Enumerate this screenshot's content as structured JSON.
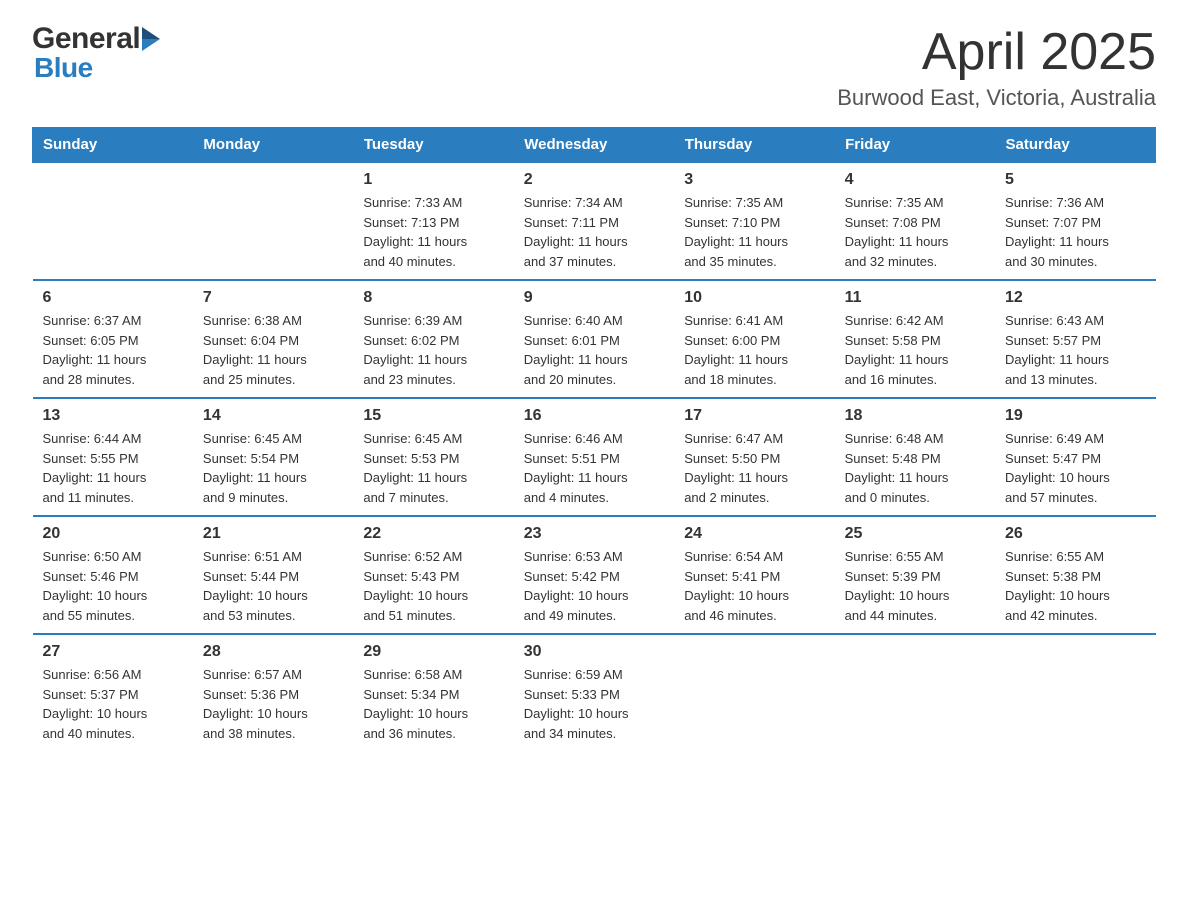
{
  "header": {
    "title": "April 2025",
    "subtitle": "Burwood East, Victoria, Australia"
  },
  "logo": {
    "general": "General",
    "blue": "Blue"
  },
  "calendar": {
    "days": [
      "Sunday",
      "Monday",
      "Tuesday",
      "Wednesday",
      "Thursday",
      "Friday",
      "Saturday"
    ],
    "weeks": [
      [
        {
          "day": "",
          "info": ""
        },
        {
          "day": "",
          "info": ""
        },
        {
          "day": "1",
          "info": "Sunrise: 7:33 AM\nSunset: 7:13 PM\nDaylight: 11 hours\nand 40 minutes."
        },
        {
          "day": "2",
          "info": "Sunrise: 7:34 AM\nSunset: 7:11 PM\nDaylight: 11 hours\nand 37 minutes."
        },
        {
          "day": "3",
          "info": "Sunrise: 7:35 AM\nSunset: 7:10 PM\nDaylight: 11 hours\nand 35 minutes."
        },
        {
          "day": "4",
          "info": "Sunrise: 7:35 AM\nSunset: 7:08 PM\nDaylight: 11 hours\nand 32 minutes."
        },
        {
          "day": "5",
          "info": "Sunrise: 7:36 AM\nSunset: 7:07 PM\nDaylight: 11 hours\nand 30 minutes."
        }
      ],
      [
        {
          "day": "6",
          "info": "Sunrise: 6:37 AM\nSunset: 6:05 PM\nDaylight: 11 hours\nand 28 minutes."
        },
        {
          "day": "7",
          "info": "Sunrise: 6:38 AM\nSunset: 6:04 PM\nDaylight: 11 hours\nand 25 minutes."
        },
        {
          "day": "8",
          "info": "Sunrise: 6:39 AM\nSunset: 6:02 PM\nDaylight: 11 hours\nand 23 minutes."
        },
        {
          "day": "9",
          "info": "Sunrise: 6:40 AM\nSunset: 6:01 PM\nDaylight: 11 hours\nand 20 minutes."
        },
        {
          "day": "10",
          "info": "Sunrise: 6:41 AM\nSunset: 6:00 PM\nDaylight: 11 hours\nand 18 minutes."
        },
        {
          "day": "11",
          "info": "Sunrise: 6:42 AM\nSunset: 5:58 PM\nDaylight: 11 hours\nand 16 minutes."
        },
        {
          "day": "12",
          "info": "Sunrise: 6:43 AM\nSunset: 5:57 PM\nDaylight: 11 hours\nand 13 minutes."
        }
      ],
      [
        {
          "day": "13",
          "info": "Sunrise: 6:44 AM\nSunset: 5:55 PM\nDaylight: 11 hours\nand 11 minutes."
        },
        {
          "day": "14",
          "info": "Sunrise: 6:45 AM\nSunset: 5:54 PM\nDaylight: 11 hours\nand 9 minutes."
        },
        {
          "day": "15",
          "info": "Sunrise: 6:45 AM\nSunset: 5:53 PM\nDaylight: 11 hours\nand 7 minutes."
        },
        {
          "day": "16",
          "info": "Sunrise: 6:46 AM\nSunset: 5:51 PM\nDaylight: 11 hours\nand 4 minutes."
        },
        {
          "day": "17",
          "info": "Sunrise: 6:47 AM\nSunset: 5:50 PM\nDaylight: 11 hours\nand 2 minutes."
        },
        {
          "day": "18",
          "info": "Sunrise: 6:48 AM\nSunset: 5:48 PM\nDaylight: 11 hours\nand 0 minutes."
        },
        {
          "day": "19",
          "info": "Sunrise: 6:49 AM\nSunset: 5:47 PM\nDaylight: 10 hours\nand 57 minutes."
        }
      ],
      [
        {
          "day": "20",
          "info": "Sunrise: 6:50 AM\nSunset: 5:46 PM\nDaylight: 10 hours\nand 55 minutes."
        },
        {
          "day": "21",
          "info": "Sunrise: 6:51 AM\nSunset: 5:44 PM\nDaylight: 10 hours\nand 53 minutes."
        },
        {
          "day": "22",
          "info": "Sunrise: 6:52 AM\nSunset: 5:43 PM\nDaylight: 10 hours\nand 51 minutes."
        },
        {
          "day": "23",
          "info": "Sunrise: 6:53 AM\nSunset: 5:42 PM\nDaylight: 10 hours\nand 49 minutes."
        },
        {
          "day": "24",
          "info": "Sunrise: 6:54 AM\nSunset: 5:41 PM\nDaylight: 10 hours\nand 46 minutes."
        },
        {
          "day": "25",
          "info": "Sunrise: 6:55 AM\nSunset: 5:39 PM\nDaylight: 10 hours\nand 44 minutes."
        },
        {
          "day": "26",
          "info": "Sunrise: 6:55 AM\nSunset: 5:38 PM\nDaylight: 10 hours\nand 42 minutes."
        }
      ],
      [
        {
          "day": "27",
          "info": "Sunrise: 6:56 AM\nSunset: 5:37 PM\nDaylight: 10 hours\nand 40 minutes."
        },
        {
          "day": "28",
          "info": "Sunrise: 6:57 AM\nSunset: 5:36 PM\nDaylight: 10 hours\nand 38 minutes."
        },
        {
          "day": "29",
          "info": "Sunrise: 6:58 AM\nSunset: 5:34 PM\nDaylight: 10 hours\nand 36 minutes."
        },
        {
          "day": "30",
          "info": "Sunrise: 6:59 AM\nSunset: 5:33 PM\nDaylight: 10 hours\nand 34 minutes."
        },
        {
          "day": "",
          "info": ""
        },
        {
          "day": "",
          "info": ""
        },
        {
          "day": "",
          "info": ""
        }
      ]
    ]
  }
}
